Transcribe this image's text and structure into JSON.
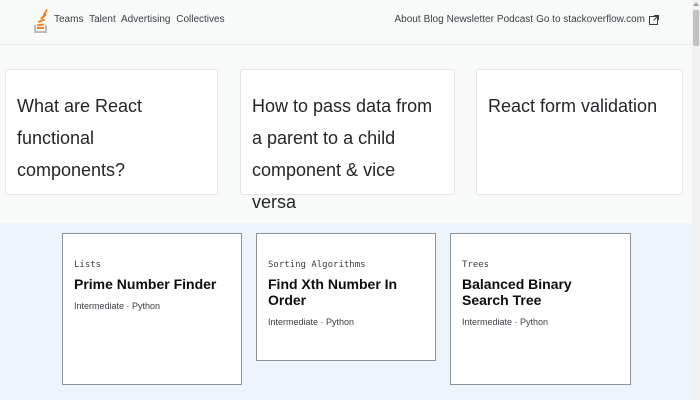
{
  "nav": {
    "left_links": [
      "Teams",
      "Talent",
      "Advertising",
      "Collectives"
    ],
    "right_links": [
      "About",
      "Blog",
      "Newsletter",
      "Podcast",
      "Go to stackoverflow.com"
    ]
  },
  "questions": [
    {
      "title": "What are React functional components?"
    },
    {
      "title": "How to pass data from a parent to a child component & vice versa"
    },
    {
      "title": "React form validation"
    }
  ],
  "challenges": [
    {
      "category": "Lists",
      "title": "Prime Number Finder",
      "meta": "Intermediate · Python"
    },
    {
      "category": "Sorting Algorithms",
      "title": "Find Xth Number In Order",
      "meta": "Intermediate · Python"
    },
    {
      "category": "Trees",
      "title": "Balanced Binary Search Tree",
      "meta": "Intermediate · Python"
    }
  ],
  "colors": {
    "brand_orange": "#f48024",
    "challenge_bg": "#eef4fb"
  },
  "icons": {
    "logo": "stackoverflow-logo-icon",
    "external": "external-link-icon"
  }
}
